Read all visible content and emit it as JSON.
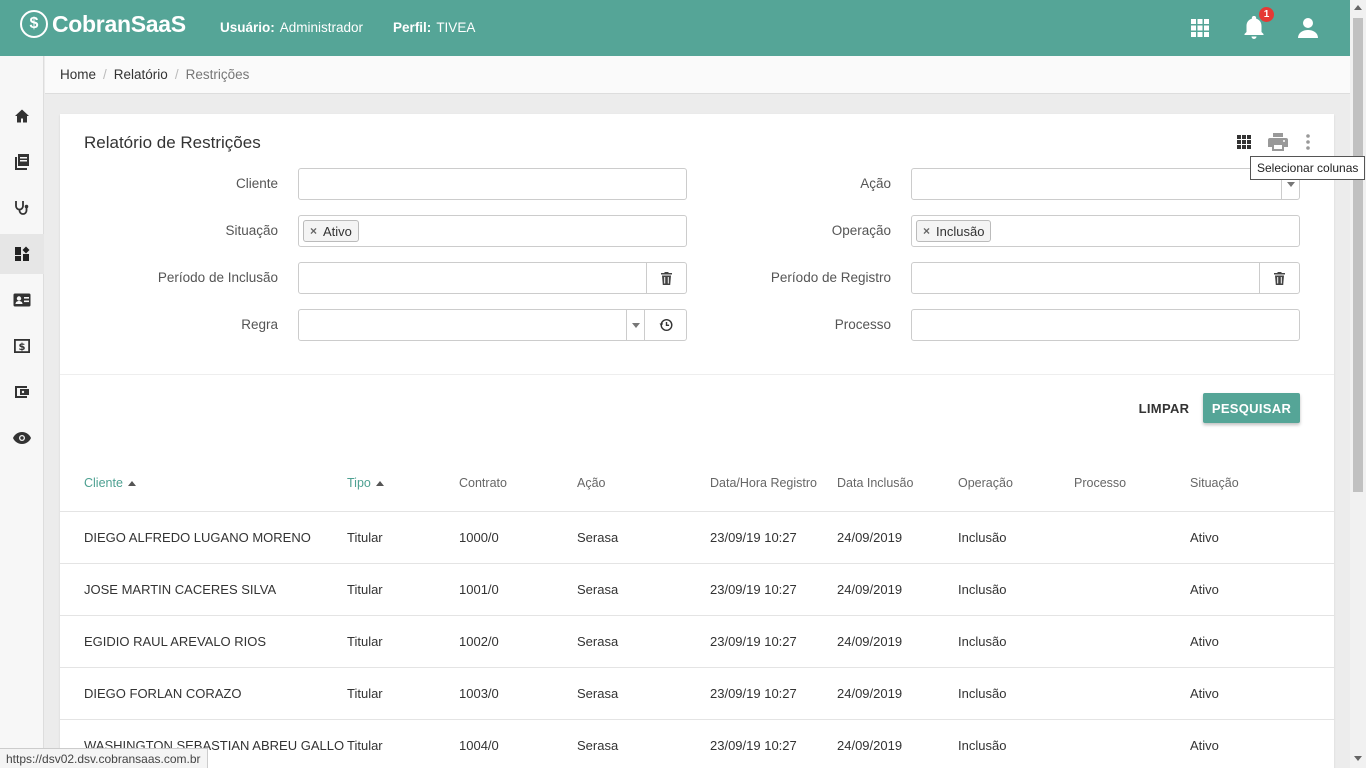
{
  "app": {
    "logo_symbol": "$",
    "logo_text": "CobranSaaS",
    "user_label": "Usuário:",
    "user_value": "Administrador",
    "profile_label": "Perfil:",
    "profile_value": "TIVEA",
    "notification_count": "1",
    "accent_color": "#55a597"
  },
  "sidebar": {
    "items": [
      {
        "icon": "home-icon"
      },
      {
        "icon": "book-icon"
      },
      {
        "icon": "stethoscope-icon"
      },
      {
        "icon": "dashboard-icon",
        "active": true
      },
      {
        "icon": "contact-card-icon"
      },
      {
        "icon": "money-icon"
      },
      {
        "icon": "wallet-icon"
      },
      {
        "icon": "eye-icon"
      }
    ]
  },
  "breadcrumb": [
    "Home",
    "Relatório",
    "Restrições"
  ],
  "report": {
    "title": "Relatório de Restrições",
    "tooltip": "Selecionar colunas"
  },
  "filters": {
    "cliente": {
      "label": "Cliente",
      "value": ""
    },
    "acao": {
      "label": "Ação",
      "value": ""
    },
    "situacao": {
      "label": "Situação",
      "chip": "Ativo"
    },
    "operacao": {
      "label": "Operação",
      "chip": "Inclusão"
    },
    "periodo_inclusao": {
      "label": "Período de Inclusão",
      "value": ""
    },
    "periodo_registro": {
      "label": "Período de Registro",
      "value": ""
    },
    "regra": {
      "label": "Regra",
      "value": ""
    },
    "processo": {
      "label": "Processo",
      "value": ""
    }
  },
  "actions": {
    "clear": "LIMPAR",
    "search": "PESQUISAR"
  },
  "table": {
    "columns": [
      "Cliente",
      "Tipo",
      "Contrato",
      "Ação",
      "Data/Hora Registro",
      "Data Inclusão",
      "Operação",
      "Processo",
      "Situação"
    ],
    "rows": [
      {
        "cliente": "DIEGO ALFREDO LUGANO MORENO",
        "tipo": "Titular",
        "contrato": "1000/0",
        "acao": "Serasa",
        "registro": "23/09/19 10:27",
        "inclusao": "24/09/2019",
        "operacao": "Inclusão",
        "processo": "",
        "situacao": "Ativo"
      },
      {
        "cliente": "JOSE MARTIN CACERES SILVA",
        "tipo": "Titular",
        "contrato": "1001/0",
        "acao": "Serasa",
        "registro": "23/09/19 10:27",
        "inclusao": "24/09/2019",
        "operacao": "Inclusão",
        "processo": "",
        "situacao": "Ativo"
      },
      {
        "cliente": "EGIDIO RAUL AREVALO RIOS",
        "tipo": "Titular",
        "contrato": "1002/0",
        "acao": "Serasa",
        "registro": "23/09/19 10:27",
        "inclusao": "24/09/2019",
        "operacao": "Inclusão",
        "processo": "",
        "situacao": "Ativo"
      },
      {
        "cliente": "DIEGO FORLAN CORAZO",
        "tipo": "Titular",
        "contrato": "1003/0",
        "acao": "Serasa",
        "registro": "23/09/19 10:27",
        "inclusao": "24/09/2019",
        "operacao": "Inclusão",
        "processo": "",
        "situacao": "Ativo"
      },
      {
        "cliente": "WASHINGTON SEBASTIAN ABREU GALLO",
        "tipo": "Titular",
        "contrato": "1004/0",
        "acao": "Serasa",
        "registro": "23/09/19 10:27",
        "inclusao": "24/09/2019",
        "operacao": "Inclusão",
        "processo": "",
        "situacao": "Ativo"
      }
    ]
  },
  "status_url": "https://dsv02.dsv.cobransaas.com.br"
}
